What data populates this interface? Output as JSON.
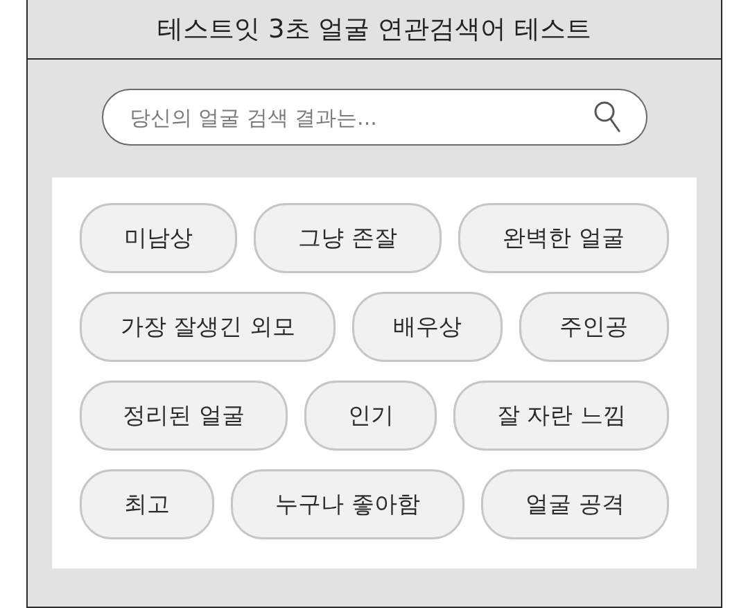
{
  "header": {
    "title": "테스트잇 3초 얼굴 연관검색어 테스트"
  },
  "search": {
    "placeholder": "당신의 얼굴 검색 결과는..."
  },
  "tags": [
    "미남상",
    "그냥 존잘",
    "완벽한 얼굴",
    "가장 잘생긴 외모",
    "배우상",
    "주인공",
    "정리된 얼굴",
    "인기",
    "잘 자란 느낌",
    "최고",
    "누구나 좋아함",
    "얼굴 공격"
  ]
}
